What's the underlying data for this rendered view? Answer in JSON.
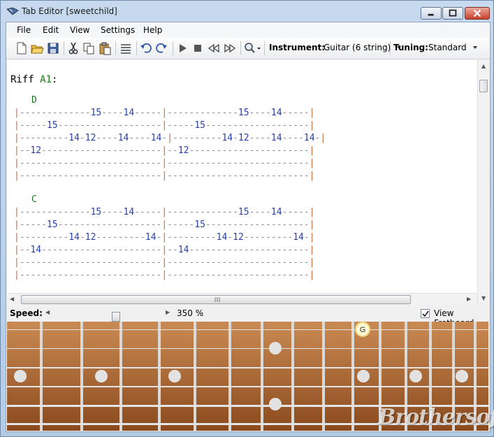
{
  "window": {
    "title": "Tab Editor [sweetchild]"
  },
  "menu": {
    "file": "File",
    "edit": "Edit",
    "view": "View",
    "settings": "Settings",
    "help": "Help"
  },
  "toolbar": {
    "instrument_label": "Instrument:",
    "instrument_value": "Guitar (6 string)",
    "tuning_label": "Tuning:",
    "tuning_value": "Standard",
    "icons": [
      "new-icon",
      "open-icon",
      "save-icon",
      "cut-icon",
      "copy-icon",
      "paste-icon",
      "align-icon",
      "undo-icon",
      "redo-icon",
      "play-icon",
      "stop-icon",
      "rewind-icon",
      "fast-forward-icon",
      "zoom-icon"
    ]
  },
  "editor": {
    "riff_prefix": "Riff",
    "riff_name": "A1",
    "riff_suffix": ":",
    "blocks": [
      {
        "chord": "D",
        "lines": [
          "|-------------15----14-----|-------------15----14-----|",
          "|-----15-------------------|-----15-------------------|",
          "|---------14-12----14----14-|---------14-12----14----14-|",
          "|--12----------------------|--12----------------------|",
          "|--------------------------|--------------------------|",
          "|--------------------------|--------------------------|"
        ]
      },
      {
        "chord": "C",
        "lines": [
          "|-------------15----14-----|-------------15----14-----|",
          "|-----15-------------------|-----15-------------------|",
          "|---------14-12---------14-|---------14-12---------14-|",
          "|--14----------------------|--14----------------------|",
          "|--------------------------|--------------------------|",
          "|--------------------------|--------------------------|"
        ]
      }
    ]
  },
  "speed": {
    "label": "Speed:",
    "value": "350 %",
    "fraction": 0.55
  },
  "fretboard": {
    "view_label": "View Fretboard",
    "checked": true,
    "highlight_note": "G"
  },
  "watermark": "Brothersoft",
  "colors": {
    "tab_number": "#2840a8",
    "chord": "#1a7a1a",
    "barline": "#c86a3a",
    "fretboard_wood": "#9a5a2c"
  }
}
